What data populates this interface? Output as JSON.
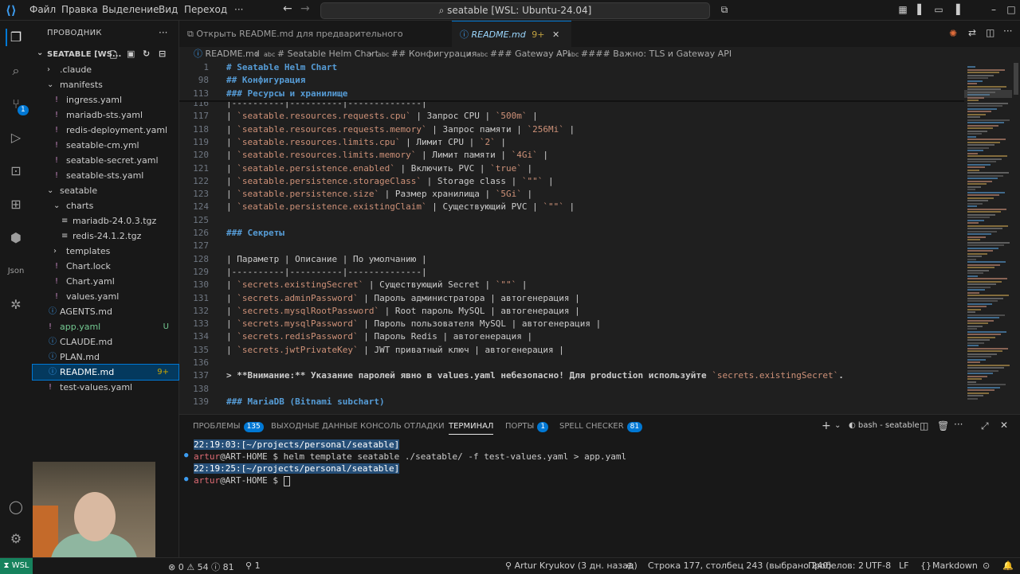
{
  "titlebar": {
    "menus": [
      "Файл",
      "Правка",
      "Выделение",
      "Вид",
      "Переход",
      "···"
    ],
    "search": "seatable [WSL: Ubuntu-24.04]"
  },
  "sidebar": {
    "header": "ПРОВОДНИК",
    "root": "SEATABLE [WS...",
    "items": [
      {
        "label": ".claude",
        "depth": 1,
        "kind": "folder",
        "open": false
      },
      {
        "label": "manifests",
        "depth": 1,
        "kind": "folder",
        "open": true
      },
      {
        "label": "ingress.yaml",
        "depth": 2,
        "kind": "yaml"
      },
      {
        "label": "mariadb-sts.yaml",
        "depth": 2,
        "kind": "yaml"
      },
      {
        "label": "redis-deployment.yaml",
        "depth": 2,
        "kind": "yaml"
      },
      {
        "label": "seatable-cm.yml",
        "depth": 2,
        "kind": "yaml"
      },
      {
        "label": "seatable-secret.yaml",
        "depth": 2,
        "kind": "yaml"
      },
      {
        "label": "seatable-sts.yaml",
        "depth": 2,
        "kind": "yaml"
      },
      {
        "label": "seatable",
        "depth": 1,
        "kind": "folder",
        "open": true
      },
      {
        "label": "charts",
        "depth": 2,
        "kind": "folder",
        "open": true
      },
      {
        "label": "mariadb-24.0.3.tgz",
        "depth": 3,
        "kind": "tgz"
      },
      {
        "label": "redis-24.1.2.tgz",
        "depth": 3,
        "kind": "tgz"
      },
      {
        "label": "templates",
        "depth": 2,
        "kind": "folder",
        "open": false
      },
      {
        "label": "Chart.lock",
        "depth": 2,
        "kind": "yaml"
      },
      {
        "label": "Chart.yaml",
        "depth": 2,
        "kind": "yaml"
      },
      {
        "label": "values.yaml",
        "depth": 2,
        "kind": "yaml"
      },
      {
        "label": "AGENTS.md",
        "depth": 1,
        "kind": "md"
      },
      {
        "label": "app.yaml",
        "depth": 1,
        "kind": "yaml",
        "status": "U"
      },
      {
        "label": "CLAUDE.md",
        "depth": 1,
        "kind": "md"
      },
      {
        "label": "PLAN.md",
        "depth": 1,
        "kind": "md"
      },
      {
        "label": "README.md",
        "depth": 1,
        "kind": "md",
        "status": "9+",
        "selected": true
      },
      {
        "label": "test-values.yaml",
        "depth": 1,
        "kind": "yaml"
      }
    ]
  },
  "tabs": [
    {
      "label": "Открыть README.md для предварительного просмотра",
      "active": false
    },
    {
      "label": "README.md",
      "badge": "9+",
      "active": true
    }
  ],
  "breadcrumb": [
    "README.md",
    "# Seatable Helm Chart",
    "## Конфигурация",
    "### Gateway API",
    "#### Важно: TLS и Gateway API"
  ],
  "sticky": [
    {
      "n": "1",
      "text": "# Seatable Helm Chart"
    },
    {
      "n": "98",
      "text": "## Конфигурация"
    },
    {
      "n": "113",
      "text": "### Ресурсы и хранилище"
    }
  ],
  "lines": [
    {
      "n": "116",
      "kind": "p",
      "text": "|----------|----------|--------------|"
    },
    {
      "n": "117",
      "kind": "p",
      "text": "| `seatable.resources.requests.cpu` | Запрос CPU | `500m` |"
    },
    {
      "n": "118",
      "kind": "p",
      "text": "| `seatable.resources.requests.memory` | Запрос памяти | `256Mi` |"
    },
    {
      "n": "119",
      "kind": "p",
      "text": "| `seatable.resources.limits.cpu` | Лимит CPU | `2` |"
    },
    {
      "n": "120",
      "kind": "p",
      "text": "| `seatable.resources.limits.memory` | Лимит памяти | `4Gi` |"
    },
    {
      "n": "121",
      "kind": "p",
      "text": "| `seatable.persistence.enabled` | Включить PVC | `true` |"
    },
    {
      "n": "122",
      "kind": "p",
      "text": "| `seatable.persistence.storageClass` | Storage class | `\"\"` |"
    },
    {
      "n": "123",
      "kind": "p",
      "text": "| `seatable.persistence.size` | Размер хранилища | `5Gi` |"
    },
    {
      "n": "124",
      "kind": "p",
      "text": "| `seatable.persistence.existingClaim` | Существующий PVC | `\"\"` |"
    },
    {
      "n": "125",
      "kind": "p",
      "text": ""
    },
    {
      "n": "126",
      "kind": "h",
      "text": "### Секреты"
    },
    {
      "n": "127",
      "kind": "p",
      "text": ""
    },
    {
      "n": "128",
      "kind": "p",
      "text": "| Параметр | Описание | По умолчанию |"
    },
    {
      "n": "129",
      "kind": "p",
      "text": "|----------|----------|--------------|"
    },
    {
      "n": "130",
      "kind": "p",
      "text": "| `secrets.existingSecret` | Существующий Secret | `\"\"` |"
    },
    {
      "n": "131",
      "kind": "p",
      "text": "| `secrets.adminPassword` | Пароль администратора | автогенерация |"
    },
    {
      "n": "132",
      "kind": "p",
      "text": "| `secrets.mysqlRootPassword` | Root пароль MySQL | автогенерация |"
    },
    {
      "n": "133",
      "kind": "p",
      "text": "| `secrets.mysqlPassword` | Пароль пользователя MySQL | автогенерация |"
    },
    {
      "n": "134",
      "kind": "p",
      "text": "| `secrets.redisPassword` | Пароль Redis | автогенерация |"
    },
    {
      "n": "135",
      "kind": "p",
      "text": "| `secrets.jwtPrivateKey` | JWT приватный ключ | автогенерация |"
    },
    {
      "n": "136",
      "kind": "p",
      "text": ""
    },
    {
      "n": "137",
      "kind": "b",
      "text": "> **Внимание:** Указание паролей явно в values.yaml небезопасно! Для production используйте `secrets.existingSecret`."
    },
    {
      "n": "138",
      "kind": "p",
      "text": ""
    },
    {
      "n": "139",
      "kind": "h",
      "text": "### MariaDB (Bitnami subchart)"
    }
  ],
  "panel": {
    "tabs": [
      {
        "label": "ПРОБЛЕМЫ",
        "badge": "135"
      },
      {
        "label": "ВЫХОДНЫЕ ДАННЫЕ"
      },
      {
        "label": "КОНСОЛЬ ОТЛАДКИ"
      },
      {
        "label": "ТЕРМИНАЛ",
        "active": true
      },
      {
        "label": "ПОРТЫ",
        "badge": "1"
      },
      {
        "label": "SPELL CHECKER",
        "badge": "81"
      }
    ],
    "terminal_name": "bash - seatable",
    "terminal": [
      {
        "kind": "prompt",
        "text": "22:19:03:[~/projects/personal/seatable]"
      },
      {
        "kind": "cmd",
        "user": "artur",
        "host": "@ART-HOME $ ",
        "cmd": "helm template seatable ./seatable/ -f test-values.yaml > app.yaml"
      },
      {
        "kind": "prompt",
        "text": "22:19:25:[~/projects/personal/seatable]"
      },
      {
        "kind": "cmd",
        "user": "artur",
        "host": "@ART-HOME $ ",
        "cmd": ""
      }
    ]
  },
  "status": {
    "remote": "WSL",
    "errors": "0",
    "warnings": "54",
    "infos": "81",
    "ports": "1",
    "author": "Artur Kryukov (3 дн. назад)",
    "position": "Строка 177, столбец 243 (выбрано 240)",
    "spaces": "Пробелов: 2",
    "encoding": "UTF-8",
    "eol": "LF",
    "language": "Markdown"
  }
}
